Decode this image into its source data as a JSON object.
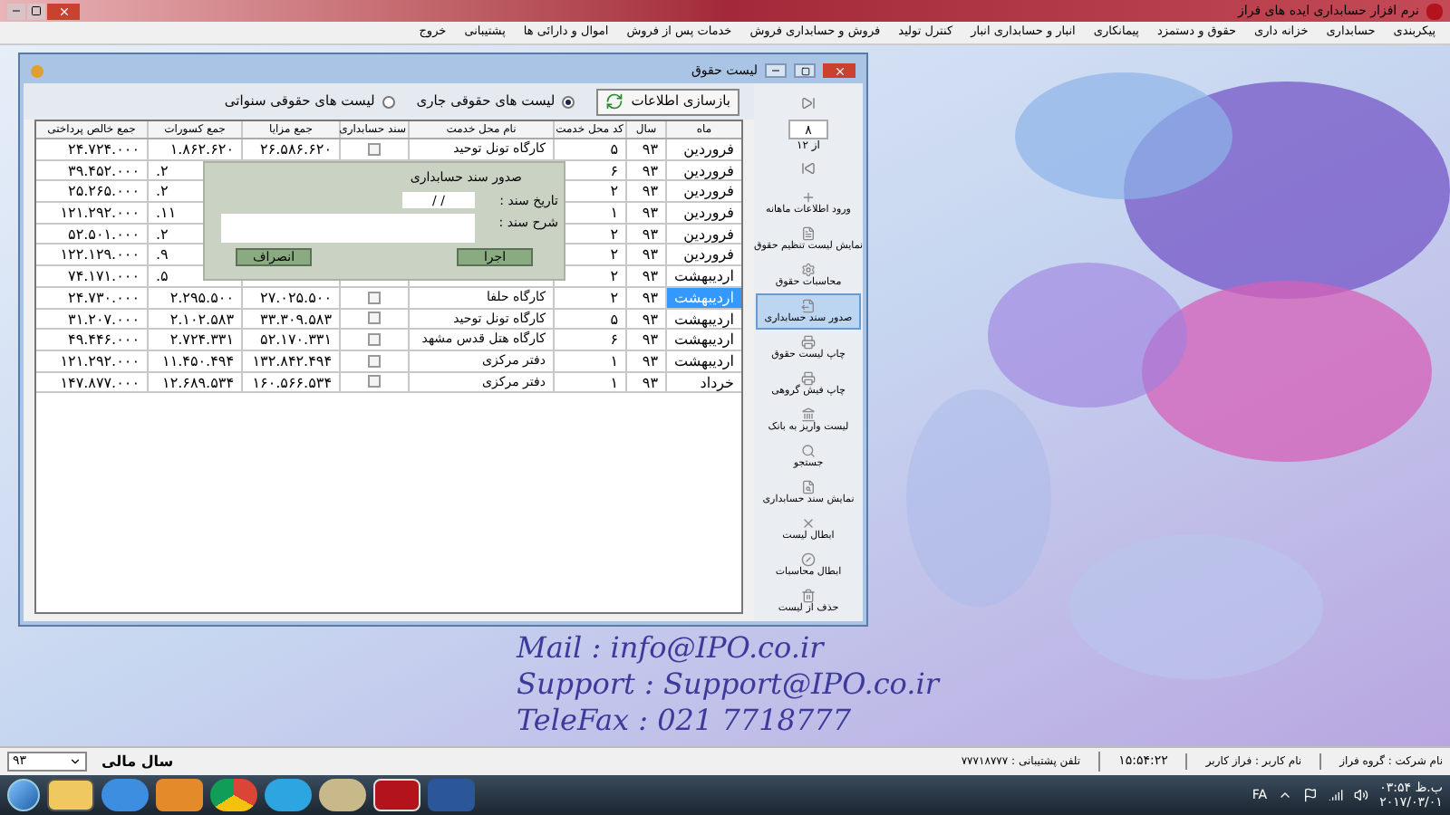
{
  "app": {
    "title": "نرم افزار حسابداری ایده های فراز",
    "menu": [
      "پیکربندی",
      "حسابداری",
      "خزانه داری",
      "حقوق و دستمزد",
      "پیمانکاری",
      "انبار و حسابداری انبار",
      "کنترل تولید",
      "فروش و حسابداری فروش",
      "خدمات پس از فروش",
      "اموال و دارائی ها",
      "پشتیبانی",
      "خروج"
    ]
  },
  "window": {
    "title": "لیست حقوق",
    "refresh_button": "بازسازی اطلاعات",
    "list_types": [
      {
        "label": "لیست های حقوقی جاری",
        "selected": true
      },
      {
        "label": "لیست های حقوقی سنواتی",
        "selected": false
      }
    ],
    "columns": [
      "ماه",
      "سال",
      "کد محل خدمت",
      "نام محل خدمت",
      "سند حسابداری",
      "جمع مزایا",
      "جمع کسورات",
      "جمع خالص پرداختی"
    ],
    "rows": [
      {
        "month": "فروردین",
        "year": "۹۳",
        "code": "۵",
        "place": "کارگاه تونل توحید",
        "checked": false,
        "benefits": "۲۶.۵۸۶.۶۲۰",
        "deductions": "۱.۸۶۲.۶۲۰",
        "net": "۲۴.۷۲۴.۰۰۰",
        "selected": false
      },
      {
        "month": "فروردین",
        "year": "۹۳",
        "code": "۶",
        "deductions": "۲.",
        "net": "۳۹.۴۵۲.۰۰۰",
        "selected": false
      },
      {
        "month": "فروردین",
        "year": "۹۳",
        "code": "۲",
        "deductions": "۲.",
        "net": "۲۵.۲۶۵.۰۰۰",
        "selected": false
      },
      {
        "month": "فروردین",
        "year": "۹۳",
        "code": "۱",
        "deductions": "۱۱.",
        "net": "۱۲۱.۲۹۲.۰۰۰",
        "selected": false
      },
      {
        "month": "فروردین",
        "year": "۹۳",
        "code": "۲",
        "deductions": "۲.",
        "net": "۵۲.۵۰۱.۰۰۰",
        "selected": false
      },
      {
        "month": "فروردین",
        "year": "۹۳",
        "code": "۲",
        "deductions": "۹.",
        "net": "۱۲۲.۱۲۹.۰۰۰",
        "selected": false
      },
      {
        "month": "اردیبهشت",
        "year": "۹۳",
        "code": "۲",
        "deductions": "۵.",
        "net": "۷۴.۱۷۱.۰۰۰",
        "selected": false
      },
      {
        "month": "اردیبهشت",
        "year": "۹۳",
        "code": "۲",
        "place": "کارگاه حلفا",
        "checked": false,
        "benefits": "۲۷.۰۲۵.۵۰۰",
        "deductions": "۲.۲۹۵.۵۰۰",
        "net": "۲۴.۷۳۰.۰۰۰",
        "selected": true
      },
      {
        "month": "اردیبهشت",
        "year": "۹۳",
        "code": "۵",
        "place": "کارگاه تونل توحید",
        "checked": false,
        "benefits": "۳۳.۳۰۹.۵۸۳",
        "deductions": "۲.۱۰۲.۵۸۳",
        "net": "۳۱.۲۰۷.۰۰۰",
        "selected": false
      },
      {
        "month": "اردیبهشت",
        "year": "۹۳",
        "code": "۶",
        "place": "کارگاه هتل قدس مشهد",
        "checked": false,
        "benefits": "۵۲.۱۷۰.۳۳۱",
        "deductions": "۲.۷۲۴.۳۳۱",
        "net": "۴۹.۴۴۶.۰۰۰",
        "selected": false
      },
      {
        "month": "اردیبهشت",
        "year": "۹۳",
        "code": "۱",
        "place": "دفتر مرکزی",
        "checked": false,
        "benefits": "۱۳۲.۸۴۲.۴۹۴",
        "deductions": "۱۱.۴۵۰.۴۹۴",
        "net": "۱۲۱.۲۹۲.۰۰۰",
        "selected": false
      },
      {
        "month": "خرداد",
        "year": "۹۳",
        "code": "۱",
        "place": "دفتر مرکزی",
        "checked": false,
        "benefits": "۱۶۰.۵۶۶.۵۳۴",
        "deductions": "۱۲.۶۸۹.۵۳۴",
        "net": "۱۴۷.۸۷۷.۰۰۰",
        "selected": false
      }
    ],
    "dialog": {
      "title": "صدور سند حسابداری",
      "date_label": "تاریخ سند :",
      "date_value": "/ /",
      "description_label": "شرح سند :",
      "run_button": "اجرا",
      "cancel_button": "انصراف"
    },
    "navigator": {
      "record": "۸",
      "of_total": "از ۱۲"
    },
    "actions": [
      {
        "label": "ورود اطلاعات ماهانه",
        "selected": false
      },
      {
        "label": "نمایش لیست تنظیم حقوق",
        "selected": false
      },
      {
        "label": "محاسبات حقوق",
        "selected": false
      },
      {
        "label": "صدور سند حسابداری",
        "selected": true
      },
      {
        "label": "چاپ لیست حقوق",
        "selected": false
      },
      {
        "label": "چاپ فیش گروهی",
        "selected": false
      },
      {
        "label": "لیست واریز به بانک",
        "selected": false
      },
      {
        "label": "جستجو",
        "selected": false
      },
      {
        "label": "نمایش سند حسابداری",
        "selected": false
      },
      {
        "label": "ابطال لیست",
        "selected": false
      },
      {
        "label": "ابطال محاسبات",
        "selected": false
      },
      {
        "label": "حذف از لیست",
        "selected": false
      }
    ]
  },
  "wallpaper_text": [
    "Mail : info@IPO.co.ir",
    "Support : Support@IPO.co.ir",
    "TeleFax : 021 7718777"
  ],
  "status_bar": {
    "year_label": "سال مالی",
    "year_value": "۹۳",
    "company": "نام شرکت : گروه فراز",
    "user": "نام کاربر : فراز کاربر",
    "time": "۱۵:۵۴:۲۲",
    "support_phone": "تلفن پشتیبانی : ۷۷۷۱۸۷۷۷"
  },
  "taskbar": {
    "language": "FA",
    "time": "ب.ظ ۰۳:۵۴",
    "date": "۲۰۱۷/۰۳/۰۱"
  }
}
